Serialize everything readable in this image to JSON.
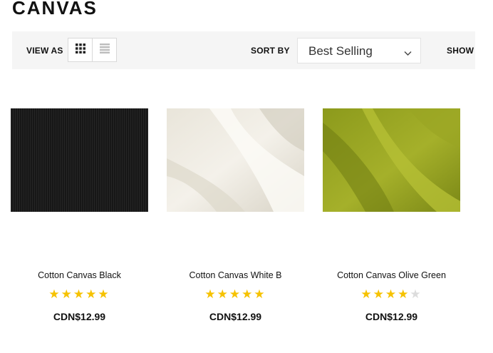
{
  "page": {
    "title": "CANVAS"
  },
  "toolbar": {
    "view_as_label": "VIEW AS",
    "view_options": [
      {
        "icon": "grid-view-icon",
        "active": true
      },
      {
        "icon": "list-view-icon",
        "active": false
      }
    ],
    "sort_by_label": "SORT BY",
    "sort_value": "Best Selling",
    "show_label": "SHOW"
  },
  "colors": {
    "star_filled": "#f6c200",
    "star_empty": "#dcdcdc",
    "toolbar_bg": "#f5f5f5"
  },
  "products": [
    {
      "name": "Cotton Canvas Black",
      "price": "CDN$12.99",
      "rating": 5,
      "rating_max": 5,
      "swatch": "black-fabric"
    },
    {
      "name": "Cotton Canvas White B",
      "price": "CDN$12.99",
      "rating": 5,
      "rating_max": 5,
      "swatch": "white-fabric"
    },
    {
      "name": "Cotton Canvas Olive Green",
      "price": "CDN$12.99",
      "rating": 4,
      "rating_max": 5,
      "swatch": "olive-fabric"
    }
  ]
}
